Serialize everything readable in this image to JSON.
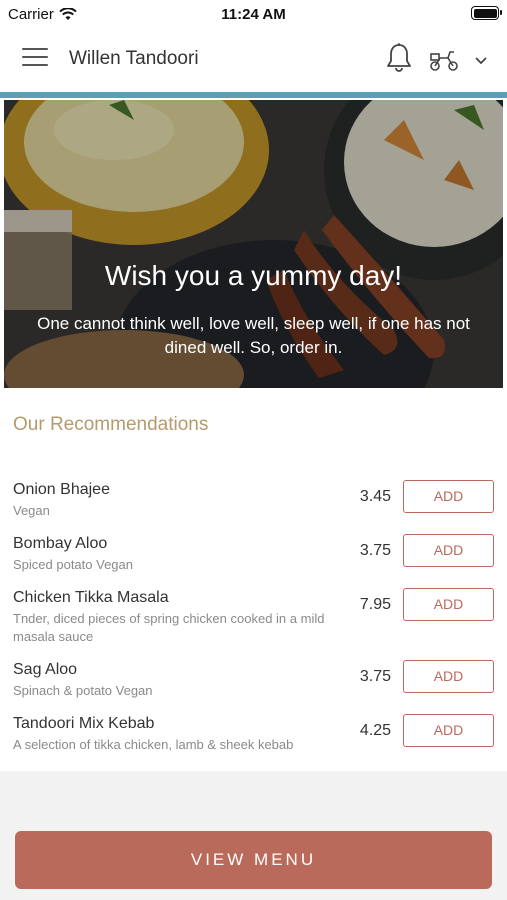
{
  "status_bar": {
    "carrier": "Carrier",
    "time": "11:24 AM"
  },
  "header": {
    "title": "Willen Tandoori",
    "icons": [
      "menu-icon",
      "bell-icon",
      "scooter-icon",
      "chevron-down-icon"
    ]
  },
  "hero": {
    "title": "Wish you a yummy day!",
    "subtitle": "One cannot think well, love well, sleep well, if one has not dined well. So, order in."
  },
  "recommendations": {
    "heading": "Our Recommendations",
    "items": [
      {
        "name": "Onion Bhajee",
        "description": "Vegan",
        "price": "3.45",
        "add_label": "ADD"
      },
      {
        "name": "Bombay Aloo",
        "description": "Spiced potato  Vegan",
        "price": "3.75",
        "add_label": "ADD"
      },
      {
        "name": "Chicken Tikka Masala",
        "description": "Tnder, diced pieces of spring chicken cooked in a mild masala sauce",
        "price": "7.95",
        "add_label": "ADD"
      },
      {
        "name": "Sag Aloo",
        "description": "Spinach & potato  Vegan",
        "price": "3.75",
        "add_label": "ADD"
      },
      {
        "name": "Tandoori Mix Kebab",
        "description": "A selection of tikka chicken, lamb & sheek kebab",
        "price": "4.25",
        "add_label": "ADD"
      }
    ]
  },
  "footer": {
    "view_menu_label": "VIEW MENU"
  },
  "colors": {
    "accent_bar": "#5aa0b4",
    "brand": "#b96a5a",
    "heading": "#b59a6e"
  }
}
